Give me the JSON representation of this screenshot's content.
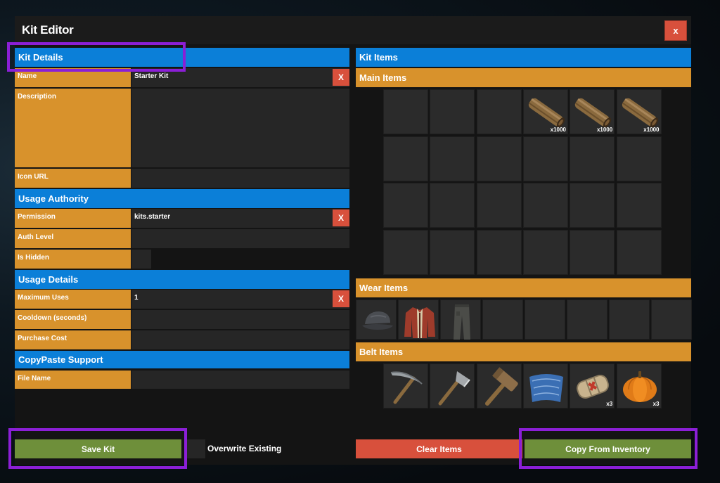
{
  "window": {
    "title": "Kit Editor",
    "close_label": "x"
  },
  "kit_details": {
    "header": "Kit Details",
    "name_label": "Name",
    "name_value": "Starter Kit",
    "name_clear": "X",
    "description_label": "Description",
    "description_value": "",
    "icon_url_label": "Icon URL",
    "icon_url_value": ""
  },
  "usage_authority": {
    "header": "Usage Authority",
    "permission_label": "Permission",
    "permission_value": "kits.starter",
    "permission_clear": "X",
    "auth_level_label": "Auth Level",
    "auth_level_value": "",
    "is_hidden_label": "Is Hidden"
  },
  "usage_details": {
    "header": "Usage Details",
    "max_uses_label": "Maximum Uses",
    "max_uses_value": "1",
    "max_uses_clear": "X",
    "cooldown_label": "Cooldown (seconds)",
    "cooldown_value": "",
    "purchase_cost_label": "Purchase Cost",
    "purchase_cost_value": ""
  },
  "copypaste": {
    "header": "CopyPaste Support",
    "file_name_label": "File Name",
    "file_name_value": ""
  },
  "kit_items": {
    "header": "Kit Items",
    "main_header": "Main Items",
    "main_items": [
      {
        "slot": 3,
        "icon": "wood-log-icon",
        "qty": "x1000"
      },
      {
        "slot": 4,
        "icon": "wood-log-icon",
        "qty": "x1000"
      },
      {
        "slot": 5,
        "icon": "wood-log-icon",
        "qty": "x1000"
      }
    ],
    "wear_header": "Wear Items",
    "wear_items": [
      {
        "icon": "cap-icon"
      },
      {
        "icon": "jacket-icon"
      },
      {
        "icon": "pants-icon"
      }
    ],
    "belt_header": "Belt Items",
    "belt_items": [
      {
        "icon": "pickaxe-icon",
        "qty": ""
      },
      {
        "icon": "hatchet-icon",
        "qty": ""
      },
      {
        "icon": "hammer-icon",
        "qty": ""
      },
      {
        "icon": "blueprint-icon",
        "qty": ""
      },
      {
        "icon": "medkit-icon",
        "qty": "x3"
      },
      {
        "icon": "pumpkin-icon",
        "qty": "x3"
      }
    ]
  },
  "footer": {
    "save_label": "Save Kit",
    "overwrite_label": "Overwrite Existing",
    "clear_label": "Clear Items",
    "copy_label": "Copy From Inventory"
  },
  "colors": {
    "blue_header": "#0b7fd8",
    "orange_header": "#d8922c",
    "red_button": "#d8503c",
    "green_button": "#6e8f3a",
    "highlight": "#8b1fd6"
  }
}
